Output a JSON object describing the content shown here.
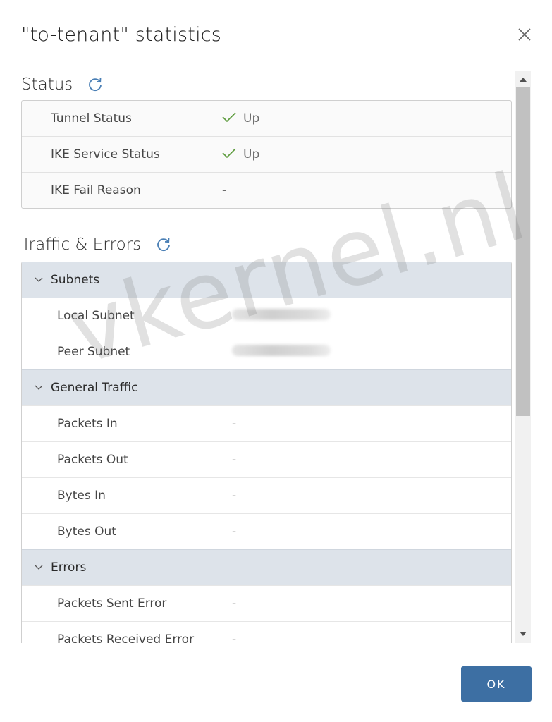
{
  "modal": {
    "title": "\"to-tenant\" statistics",
    "ok_label": "OK"
  },
  "status": {
    "title": "Status",
    "rows": [
      {
        "label": "Tunnel Status",
        "value": "Up",
        "icon": "check-icon"
      },
      {
        "label": "IKE Service Status",
        "value": "Up",
        "icon": "check-icon"
      },
      {
        "label": "IKE Fail Reason",
        "value": "-"
      }
    ]
  },
  "traffic": {
    "title": "Traffic & Errors",
    "groups": [
      {
        "name": "Subnets",
        "rows": [
          {
            "label": "Local Subnet",
            "value": ""
          },
          {
            "label": "Peer Subnet",
            "value": ""
          }
        ]
      },
      {
        "name": "General Traffic",
        "rows": [
          {
            "label": "Packets In",
            "value": "-"
          },
          {
            "label": "Packets Out",
            "value": "-"
          },
          {
            "label": "Bytes In",
            "value": "-"
          },
          {
            "label": "Bytes Out",
            "value": "-"
          }
        ]
      },
      {
        "name": "Errors",
        "rows": [
          {
            "label": "Packets Sent Error",
            "value": "-"
          },
          {
            "label": "Packets Received Error",
            "value": "-"
          }
        ]
      }
    ]
  },
  "watermark": "vkernel.nl",
  "colors": {
    "accent": "#3d6fa3",
    "refresh": "#4a7fb5",
    "success": "#5a9a3a",
    "group_header_bg": "#dde3ea"
  }
}
